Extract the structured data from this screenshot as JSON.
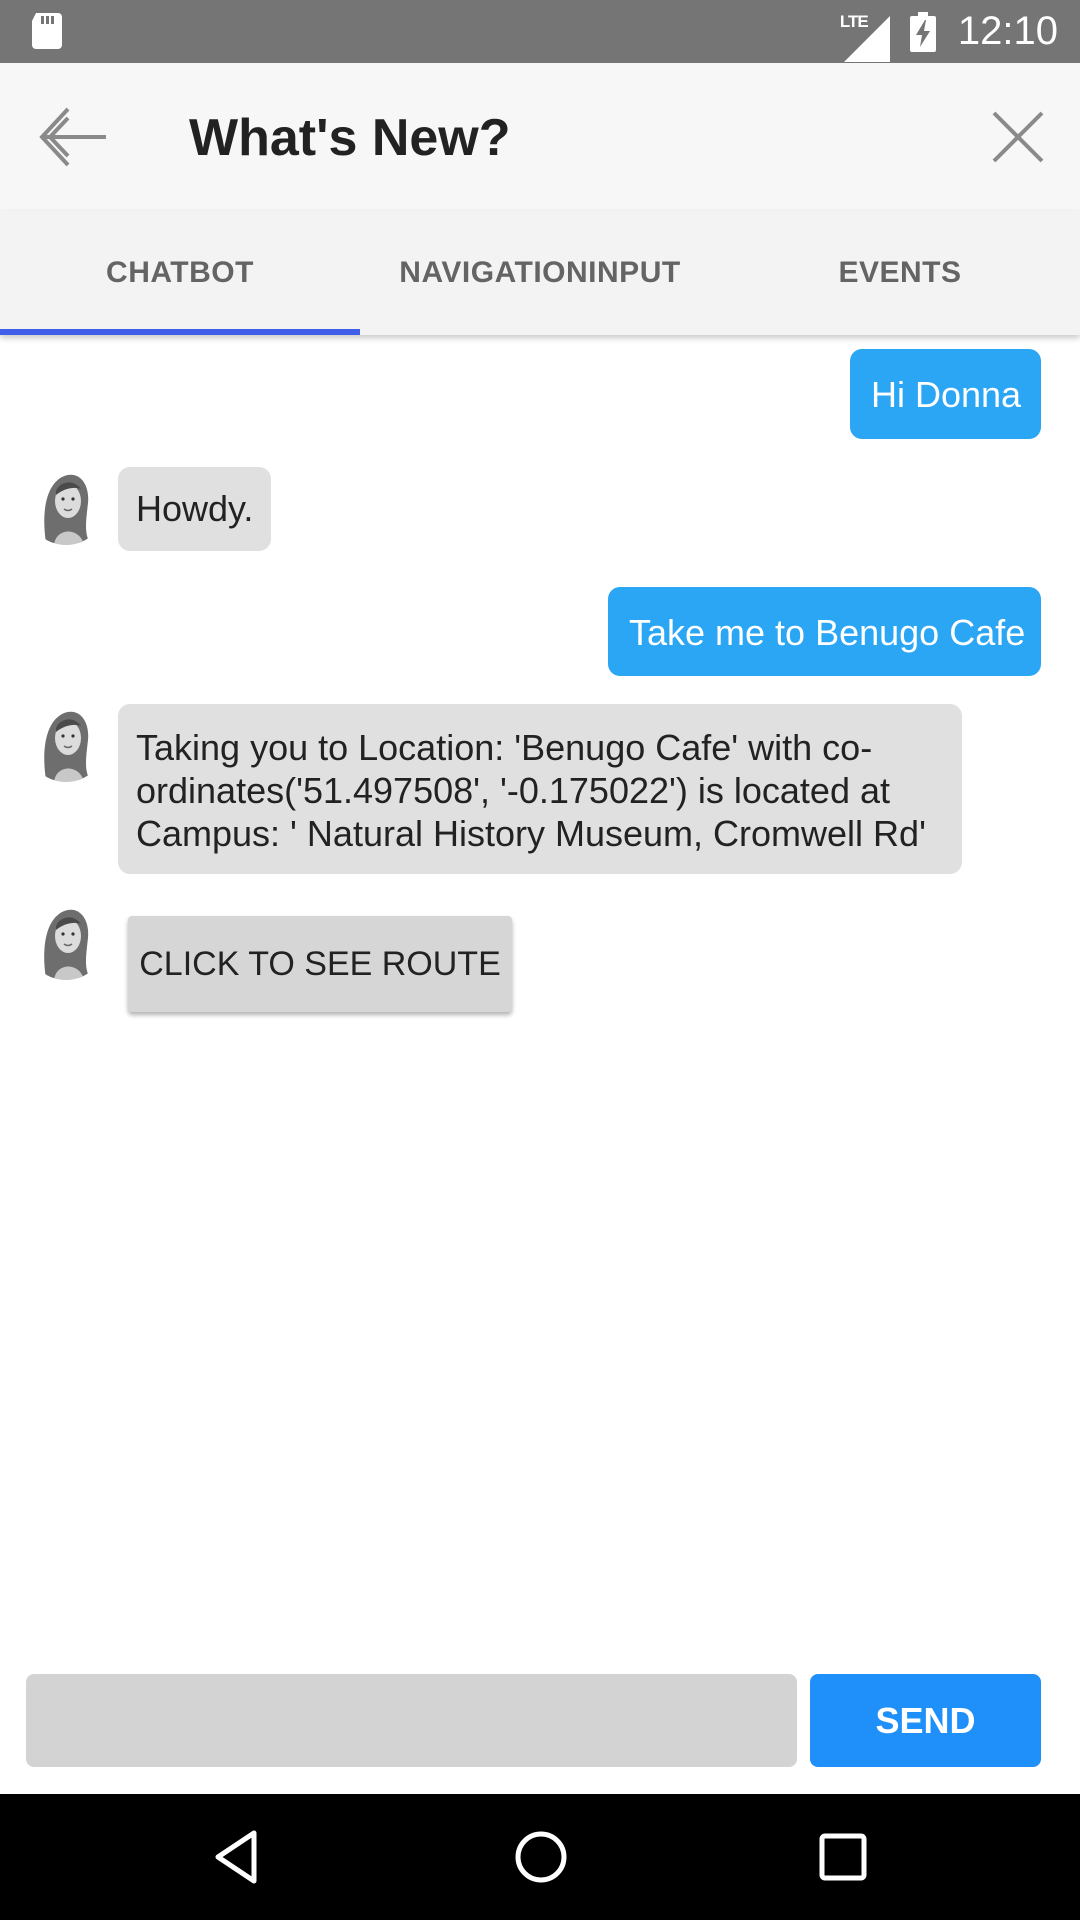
{
  "status_bar": {
    "network": "LTE",
    "time": "12:10",
    "icons": [
      "sd-card-icon",
      "signal-icon",
      "battery-charging-icon"
    ]
  },
  "app_bar": {
    "title": "What's New?",
    "back_icon": "arrow-left-icon",
    "close_icon": "close-icon"
  },
  "tabs": [
    {
      "label": "CHATBOT",
      "selected": true
    },
    {
      "label": "NAVIGATIONINPUT",
      "selected": false
    },
    {
      "label": "EVENTS",
      "selected": false
    }
  ],
  "colors": {
    "accent": "#3f5ee9",
    "user_bubble": "#2aa6f5",
    "bot_bubble": "#e0e0e0",
    "send_button": "#1f90f9"
  },
  "messages": [
    {
      "from": "user",
      "text": "Hi Donna"
    },
    {
      "from": "bot",
      "text": "Howdy."
    },
    {
      "from": "user",
      "text": "Take me to Benugo Cafe"
    },
    {
      "from": "bot",
      "lines": [
        "Taking you to Location: 'Benugo Cafe' with co-",
        "ordinates('51.497508', '-0.175022') is located at",
        "Campus: ' Natural History Museum, Cromwell Rd'"
      ]
    },
    {
      "from": "bot",
      "button": "CLICK TO SEE ROUTE"
    }
  ],
  "composer": {
    "input_value": "",
    "send_label": "SEND"
  },
  "nav_bar": {
    "icons": [
      "back-triangle-icon",
      "home-circle-icon",
      "recents-square-icon"
    ]
  }
}
